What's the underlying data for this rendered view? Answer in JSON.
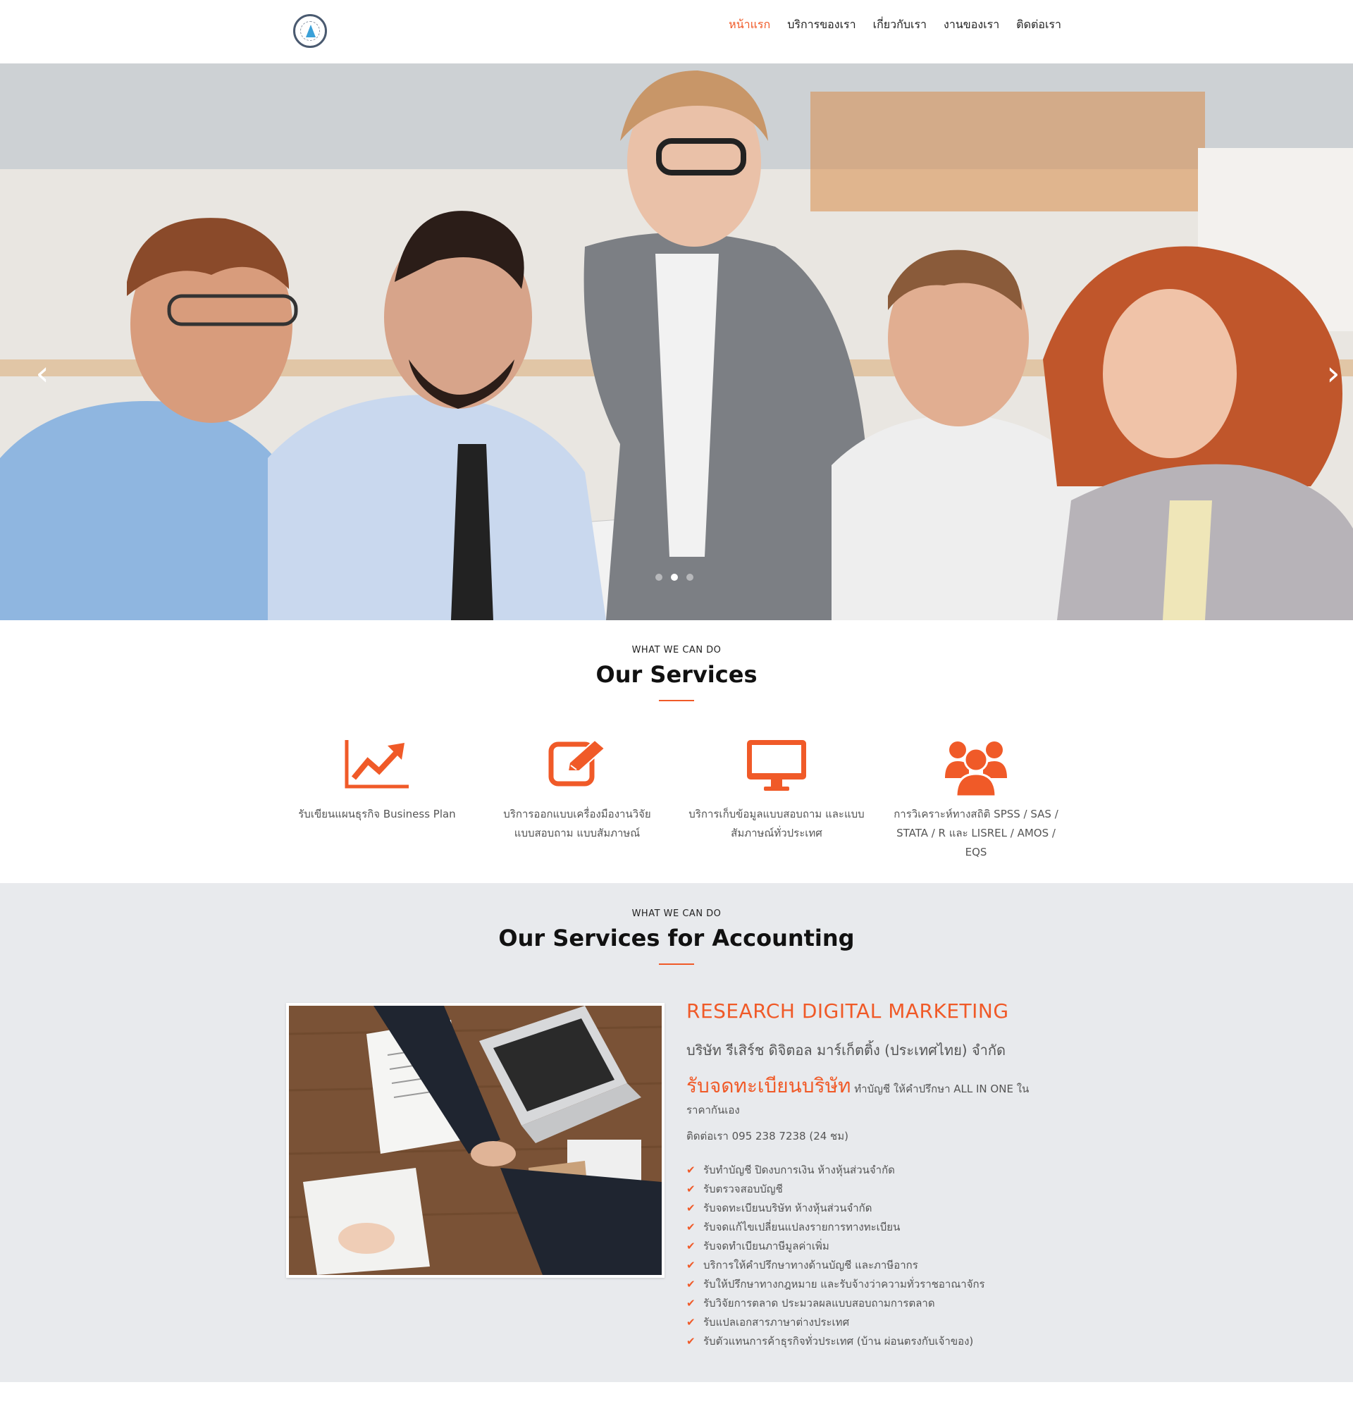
{
  "nav": {
    "items": [
      {
        "label": "หน้าแรก",
        "active": true
      },
      {
        "label": "บริการของเรา",
        "active": false
      },
      {
        "label": "เกี่ยวกับเรา",
        "active": false
      },
      {
        "label": "งานของเรา",
        "active": false
      },
      {
        "label": "ติดต่อเรา",
        "active": false
      }
    ]
  },
  "hero": {
    "prev_icon": "chevron-left-icon",
    "next_icon": "chevron-right-icon",
    "slide_count": 3,
    "active_slide": 2
  },
  "services": {
    "eyebrow": "WHAT WE CAN DO",
    "title": "Our Services",
    "items": [
      {
        "icon": "line-chart-icon",
        "line1": "รับเขียนแผนธุรกิจ Business Plan",
        "line2": ""
      },
      {
        "icon": "edit-icon",
        "line1": "บริการออกแบบเครื่องมืองานวิจัย",
        "line2": "แบบสอบถาม แบบสัมภาษณ์"
      },
      {
        "icon": "monitor-icon",
        "line1": "บริการเก็บข้อมูลแบบสอบถาม และแบบ",
        "line2": "สัมภาษณ์ทั่วประเทศ"
      },
      {
        "icon": "users-icon",
        "line1": "การวิเคราะห์ทางสถิติ SPSS / SAS /",
        "line2": "STATA / R และ LISREL / AMOS / EQS"
      }
    ]
  },
  "accounting": {
    "eyebrow": "WHAT WE CAN DO",
    "title": "Our Services for Accounting",
    "company_title": "RESEARCH DIGITAL MARKETING",
    "company_name": "บริษัท รีเสิร์ช ดิจิตอล มาร์เก็ตติ้ง (ประเทศไทย) จำกัด",
    "highlight": "รับจดทะเบียนบริษัท",
    "description": "ทำบัญชี ให้คำปรึกษา ALL IN ONE ในราคากันเอง",
    "phone": "ติดต่อเรา 095 238 7238 (24 ชม)",
    "check_icon": "check-icon",
    "list": [
      "รับทำบัญชี ปิดงบการเงิน ห้างหุ้นส่วนจำกัด",
      "รับตรวจสอบบัญชี",
      "รับจดทะเบียนบริษัท ห้างหุ้นส่วนจำกัด",
      "รับจดแก้ไขเปลี่ยนแปลงรายการทางทะเบียน",
      "รับจดทำเบียนภาษีมูลค่าเพิ่ม",
      "บริการให้คำปรึกษาทางด้านบัญชี และภาษีอากร",
      "รับให้ปรึกษาทางกฎหมาย และรับจ้างว่าความทั่วราชอาณาจักร",
      "รับวิจัยการตลาด ประมวลผลแบบสอบถามการตลาด",
      "รับแปลเอกสารภาษาต่างประเทศ",
      "รับตัวแทนการค้าธุรกิจทั่วประเทศ (บ้าน ผ่อนตรงกับเจ้าของ)"
    ]
  },
  "colors": {
    "accent": "#f05a28",
    "gray_bg": "#e8eaed"
  }
}
